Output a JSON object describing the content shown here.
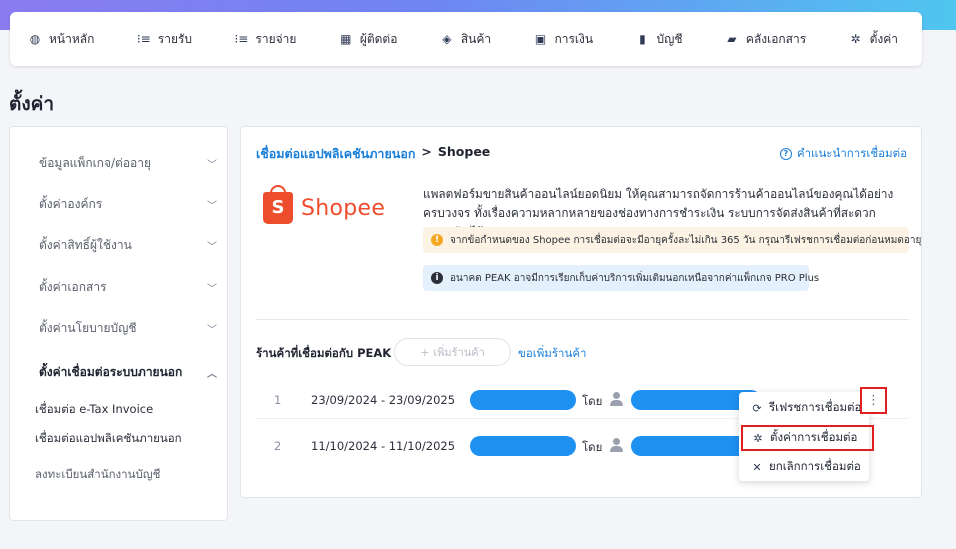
{
  "nav": {
    "items": [
      {
        "label": "หน้าหลัก",
        "icon": "dashboard-icon",
        "glyph": "◍"
      },
      {
        "label": "รายรับ",
        "icon": "income-list-icon",
        "glyph": "⁝≡"
      },
      {
        "label": "รายจ่าย",
        "icon": "expense-list-icon",
        "glyph": "⁝≡"
      },
      {
        "label": "ผู้ติดต่อ",
        "icon": "contacts-icon",
        "glyph": "▦"
      },
      {
        "label": "สินค้า",
        "icon": "product-box-icon",
        "glyph": "◈"
      },
      {
        "label": "การเงิน",
        "icon": "money-icon",
        "glyph": "▣"
      },
      {
        "label": "บัญชี",
        "icon": "ledger-book-icon",
        "glyph": "▮"
      },
      {
        "label": "คลังเอกสาร",
        "icon": "folder-icon",
        "glyph": "▰"
      },
      {
        "label": "ตั้งค่า",
        "icon": "gear-icon",
        "glyph": "✲"
      }
    ]
  },
  "page": {
    "title": "ตั้งค่า"
  },
  "sidebar": {
    "items": [
      {
        "label": "ข้อมูลแพ็กเกจ/ต่ออายุ"
      },
      {
        "label": "ตั้งค่าองค์กร"
      },
      {
        "label": "ตั้งค่าสิทธิ์ผู้ใช้งาน"
      },
      {
        "label": "ตั้งค่าเอกสาร"
      },
      {
        "label": "ตั้งค่านโยบายบัญชี"
      },
      {
        "label": "ตั้งค่าเชื่อมต่อระบบภายนอก"
      }
    ],
    "subitems": [
      {
        "label": "เชื่อมต่อ e-Tax Invoice"
      },
      {
        "label": "เชื่อมต่อแอปพลิเคชันภายนอก"
      },
      {
        "label": "ลงทะเบียนสำนักงานบัญชี"
      }
    ]
  },
  "main": {
    "breadcrumb": {
      "parent": "เชื่อมต่อแอปพลิเคชันภายนอก",
      "separator": ">",
      "current": "Shopee"
    },
    "guide_link": "คำแนะนำการเชื่อมต่อ",
    "logo": {
      "bag_letter": "S",
      "text": "Shopee",
      "color": "#ee4d2d"
    },
    "description": "แพลตฟอร์มขายสินค้าออนไลน์ยอดนิยม ให้คุณสามารถจัดการร้านค้าออนไลน์ของคุณได้อย่างครบวงจร ทั้งเรื่องความหลากหลายของช่องทางการชำระเงิน ระบบการจัดส่งสินค้าที่สะดวก ปลอดภัย ไร้ความยุ่งยาก",
    "warning": "จากข้อกำหนดของ Shopee การเชื่อมต่อจะมีอายุครั้งละไม่เกิน 365 วัน กรุณารีเฟรชการเชื่อมต่อก่อนหมดอายุ",
    "info": "อนาคต PEAK อาจมีการเรียกเก็บค่าบริการเพิ่มเติมนอกเหนือจากค่าแพ็กเกจ PRO Plus",
    "shops_label": "ร้านค้าที่เชื่อมต่อกับ PEAK",
    "add_shop": "เพิ่มร้านค้า",
    "request_shop": "ขอเพิ่มร้านค้า",
    "rows": [
      {
        "num": "1",
        "date_range": "23/09/2024 - 23/09/2025",
        "by": "โดย"
      },
      {
        "num": "2",
        "date_range": "11/10/2024 - 11/10/2025",
        "by": "โดย"
      }
    ]
  },
  "menu": {
    "kebab_glyph": "⋮",
    "items": [
      {
        "label": "รีเฟรชการเชื่อมต่อ",
        "icon": "refresh-icon",
        "glyph": "⟳"
      },
      {
        "label": "ตั้งค่าการเชื่อมต่อ",
        "icon": "gear-icon",
        "glyph": "✲"
      },
      {
        "label": "ยกเลิกการเชื่อมต่อ",
        "icon": "close-icon",
        "glyph": "✕"
      }
    ]
  },
  "colors": {
    "accent": "#1a7fd9",
    "highlight": "#e02020",
    "redaction": "#1e90f0"
  }
}
